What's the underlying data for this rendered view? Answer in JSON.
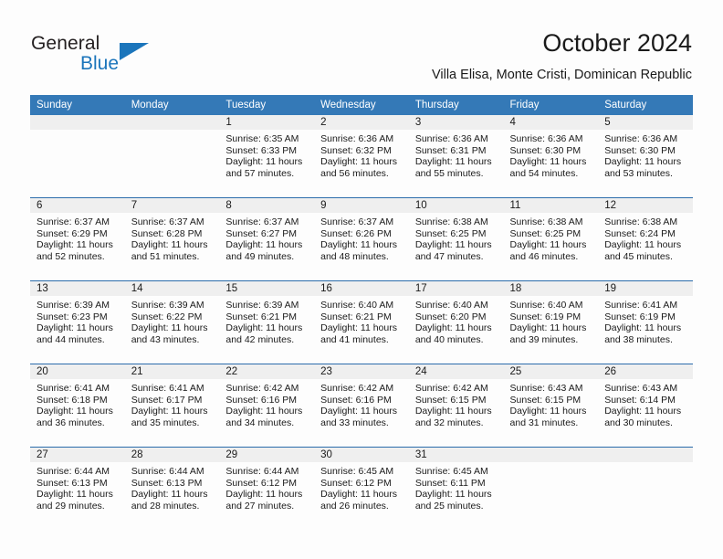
{
  "brand": {
    "name_primary": "General",
    "name_secondary": "Blue",
    "logo_icon": "triangle-icon"
  },
  "header": {
    "title": "October 2024",
    "subtitle": "Villa Elisa, Monte Cristi, Dominican Republic"
  },
  "colors": {
    "header_blue": "#3479b7",
    "row_divider_blue": "#2b6cab",
    "brand_blue": "#1b75bb",
    "daynum_band": "#efefef",
    "page_background": "#fdfdfd",
    "text": "#1a1a1a"
  },
  "calendar": {
    "weekday_headers": [
      "Sunday",
      "Monday",
      "Tuesday",
      "Wednesday",
      "Thursday",
      "Friday",
      "Saturday"
    ],
    "weeks": [
      [
        null,
        null,
        {
          "day": "1",
          "sunrise": "Sunrise: 6:35 AM",
          "sunset": "Sunset: 6:33 PM",
          "daylight_1": "Daylight: 11 hours",
          "daylight_2": "and 57 minutes."
        },
        {
          "day": "2",
          "sunrise": "Sunrise: 6:36 AM",
          "sunset": "Sunset: 6:32 PM",
          "daylight_1": "Daylight: 11 hours",
          "daylight_2": "and 56 minutes."
        },
        {
          "day": "3",
          "sunrise": "Sunrise: 6:36 AM",
          "sunset": "Sunset: 6:31 PM",
          "daylight_1": "Daylight: 11 hours",
          "daylight_2": "and 55 minutes."
        },
        {
          "day": "4",
          "sunrise": "Sunrise: 6:36 AM",
          "sunset": "Sunset: 6:30 PM",
          "daylight_1": "Daylight: 11 hours",
          "daylight_2": "and 54 minutes."
        },
        {
          "day": "5",
          "sunrise": "Sunrise: 6:36 AM",
          "sunset": "Sunset: 6:30 PM",
          "daylight_1": "Daylight: 11 hours",
          "daylight_2": "and 53 minutes."
        }
      ],
      [
        {
          "day": "6",
          "sunrise": "Sunrise: 6:37 AM",
          "sunset": "Sunset: 6:29 PM",
          "daylight_1": "Daylight: 11 hours",
          "daylight_2": "and 52 minutes."
        },
        {
          "day": "7",
          "sunrise": "Sunrise: 6:37 AM",
          "sunset": "Sunset: 6:28 PM",
          "daylight_1": "Daylight: 11 hours",
          "daylight_2": "and 51 minutes."
        },
        {
          "day": "8",
          "sunrise": "Sunrise: 6:37 AM",
          "sunset": "Sunset: 6:27 PM",
          "daylight_1": "Daylight: 11 hours",
          "daylight_2": "and 49 minutes."
        },
        {
          "day": "9",
          "sunrise": "Sunrise: 6:37 AM",
          "sunset": "Sunset: 6:26 PM",
          "daylight_1": "Daylight: 11 hours",
          "daylight_2": "and 48 minutes."
        },
        {
          "day": "10",
          "sunrise": "Sunrise: 6:38 AM",
          "sunset": "Sunset: 6:25 PM",
          "daylight_1": "Daylight: 11 hours",
          "daylight_2": "and 47 minutes."
        },
        {
          "day": "11",
          "sunrise": "Sunrise: 6:38 AM",
          "sunset": "Sunset: 6:25 PM",
          "daylight_1": "Daylight: 11 hours",
          "daylight_2": "and 46 minutes."
        },
        {
          "day": "12",
          "sunrise": "Sunrise: 6:38 AM",
          "sunset": "Sunset: 6:24 PM",
          "daylight_1": "Daylight: 11 hours",
          "daylight_2": "and 45 minutes."
        }
      ],
      [
        {
          "day": "13",
          "sunrise": "Sunrise: 6:39 AM",
          "sunset": "Sunset: 6:23 PM",
          "daylight_1": "Daylight: 11 hours",
          "daylight_2": "and 44 minutes."
        },
        {
          "day": "14",
          "sunrise": "Sunrise: 6:39 AM",
          "sunset": "Sunset: 6:22 PM",
          "daylight_1": "Daylight: 11 hours",
          "daylight_2": "and 43 minutes."
        },
        {
          "day": "15",
          "sunrise": "Sunrise: 6:39 AM",
          "sunset": "Sunset: 6:21 PM",
          "daylight_1": "Daylight: 11 hours",
          "daylight_2": "and 42 minutes."
        },
        {
          "day": "16",
          "sunrise": "Sunrise: 6:40 AM",
          "sunset": "Sunset: 6:21 PM",
          "daylight_1": "Daylight: 11 hours",
          "daylight_2": "and 41 minutes."
        },
        {
          "day": "17",
          "sunrise": "Sunrise: 6:40 AM",
          "sunset": "Sunset: 6:20 PM",
          "daylight_1": "Daylight: 11 hours",
          "daylight_2": "and 40 minutes."
        },
        {
          "day": "18",
          "sunrise": "Sunrise: 6:40 AM",
          "sunset": "Sunset: 6:19 PM",
          "daylight_1": "Daylight: 11 hours",
          "daylight_2": "and 39 minutes."
        },
        {
          "day": "19",
          "sunrise": "Sunrise: 6:41 AM",
          "sunset": "Sunset: 6:19 PM",
          "daylight_1": "Daylight: 11 hours",
          "daylight_2": "and 38 minutes."
        }
      ],
      [
        {
          "day": "20",
          "sunrise": "Sunrise: 6:41 AM",
          "sunset": "Sunset: 6:18 PM",
          "daylight_1": "Daylight: 11 hours",
          "daylight_2": "and 36 minutes."
        },
        {
          "day": "21",
          "sunrise": "Sunrise: 6:41 AM",
          "sunset": "Sunset: 6:17 PM",
          "daylight_1": "Daylight: 11 hours",
          "daylight_2": "and 35 minutes."
        },
        {
          "day": "22",
          "sunrise": "Sunrise: 6:42 AM",
          "sunset": "Sunset: 6:16 PM",
          "daylight_1": "Daylight: 11 hours",
          "daylight_2": "and 34 minutes."
        },
        {
          "day": "23",
          "sunrise": "Sunrise: 6:42 AM",
          "sunset": "Sunset: 6:16 PM",
          "daylight_1": "Daylight: 11 hours",
          "daylight_2": "and 33 minutes."
        },
        {
          "day": "24",
          "sunrise": "Sunrise: 6:42 AM",
          "sunset": "Sunset: 6:15 PM",
          "daylight_1": "Daylight: 11 hours",
          "daylight_2": "and 32 minutes."
        },
        {
          "day": "25",
          "sunrise": "Sunrise: 6:43 AM",
          "sunset": "Sunset: 6:15 PM",
          "daylight_1": "Daylight: 11 hours",
          "daylight_2": "and 31 minutes."
        },
        {
          "day": "26",
          "sunrise": "Sunrise: 6:43 AM",
          "sunset": "Sunset: 6:14 PM",
          "daylight_1": "Daylight: 11 hours",
          "daylight_2": "and 30 minutes."
        }
      ],
      [
        {
          "day": "27",
          "sunrise": "Sunrise: 6:44 AM",
          "sunset": "Sunset: 6:13 PM",
          "daylight_1": "Daylight: 11 hours",
          "daylight_2": "and 29 minutes."
        },
        {
          "day": "28",
          "sunrise": "Sunrise: 6:44 AM",
          "sunset": "Sunset: 6:13 PM",
          "daylight_1": "Daylight: 11 hours",
          "daylight_2": "and 28 minutes."
        },
        {
          "day": "29",
          "sunrise": "Sunrise: 6:44 AM",
          "sunset": "Sunset: 6:12 PM",
          "daylight_1": "Daylight: 11 hours",
          "daylight_2": "and 27 minutes."
        },
        {
          "day": "30",
          "sunrise": "Sunrise: 6:45 AM",
          "sunset": "Sunset: 6:12 PM",
          "daylight_1": "Daylight: 11 hours",
          "daylight_2": "and 26 minutes."
        },
        {
          "day": "31",
          "sunrise": "Sunrise: 6:45 AM",
          "sunset": "Sunset: 6:11 PM",
          "daylight_1": "Daylight: 11 hours",
          "daylight_2": "and 25 minutes."
        },
        null,
        null
      ]
    ]
  }
}
